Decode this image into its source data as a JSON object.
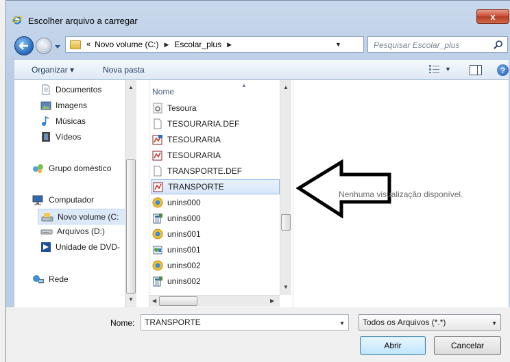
{
  "window": {
    "title": "Escolher arquivo a carregar",
    "close_label": "x"
  },
  "navigation": {
    "breadcrumb": [
      "Novo volume (C:)",
      "Escolar_plus"
    ],
    "overflow_symbol": "«",
    "search_placeholder": "Pesquisar Escolar_plus"
  },
  "toolbar": {
    "organize_label": "Organizar ▾",
    "new_folder_label": "Nova pasta"
  },
  "sidebar": {
    "items": [
      {
        "label": "Documentos",
        "icon": "document-icon"
      },
      {
        "label": "Imagens",
        "icon": "image-icon"
      },
      {
        "label": "Músicas",
        "icon": "music-icon"
      },
      {
        "label": "Vídeos",
        "icon": "video-icon"
      },
      {
        "label": "Grupo doméstico",
        "icon": "homegroup-icon"
      },
      {
        "label": "Computador",
        "icon": "computer-icon"
      },
      {
        "label": "Novo volume (C:",
        "icon": "drive-icon",
        "selected": true
      },
      {
        "label": "Arquivos (D:)",
        "icon": "drive-icon"
      },
      {
        "label": "Unidade de DVD-",
        "icon": "dvd-icon"
      },
      {
        "label": "Rede",
        "icon": "network-icon"
      }
    ]
  },
  "file_list": {
    "column_header": "Nome",
    "files": [
      {
        "name": "Tesoura",
        "icon": "settings-file-icon"
      },
      {
        "name": "TESOURARIA.DEF",
        "icon": "blank-file-icon"
      },
      {
        "name": "TESOURARIA",
        "icon": "report-file-icon"
      },
      {
        "name": "TESOURARIA",
        "icon": "report-file-icon"
      },
      {
        "name": "TRANSPORTE.DEF",
        "icon": "blank-file-icon"
      },
      {
        "name": "TRANSPORTE",
        "icon": "report-file-icon",
        "selected": true
      },
      {
        "name": "unins000",
        "icon": "uninstall-icon"
      },
      {
        "name": "unins000",
        "icon": "executable-icon"
      },
      {
        "name": "unins001",
        "icon": "uninstall-icon"
      },
      {
        "name": "unins001",
        "icon": "installer-icon"
      },
      {
        "name": "unins002",
        "icon": "uninstall-icon"
      },
      {
        "name": "unins002",
        "icon": "executable-icon"
      }
    ]
  },
  "preview": {
    "message": "Nenhuma visualização disponível."
  },
  "footer": {
    "name_label": "Nome:",
    "name_value": "TRANSPORTE",
    "filter_value": "Todos os Arquivos (*.*)",
    "open_label": "Abrir",
    "cancel_label": "Cancelar"
  },
  "colors": {
    "frame": "#b9cde6",
    "selection": "#d7e7f9",
    "close_button": "#c94a33"
  }
}
